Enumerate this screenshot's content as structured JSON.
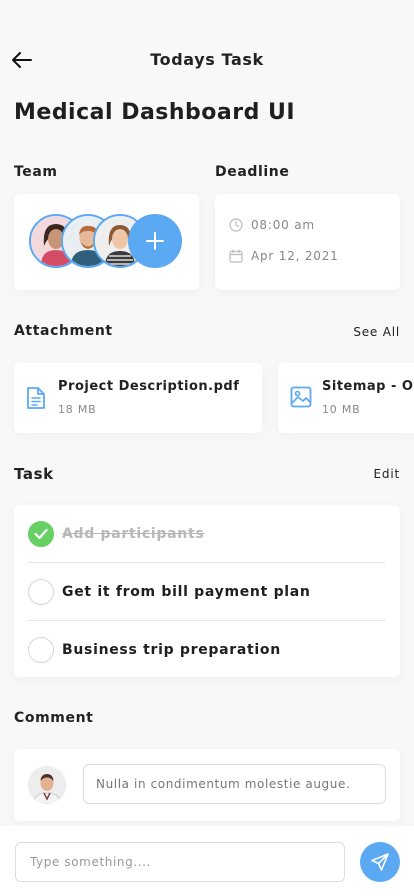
{
  "header": {
    "title": "Todays Task",
    "back_icon": "arrow-left-icon"
  },
  "page_title": "Medical Dashboard UI",
  "team": {
    "label": "Team",
    "add_icon": "plus-icon"
  },
  "deadline": {
    "label": "Deadline",
    "time": "08:00 am",
    "date": "Apr 12, 2021"
  },
  "attachments": {
    "label": "Attachment",
    "see_all": "See All",
    "items": [
      {
        "name": "Project Description.pdf",
        "size": "18 MB",
        "icon": "document-icon"
      },
      {
        "name": "Sitemap - Over",
        "size": "10 MB",
        "icon": "image-icon"
      }
    ]
  },
  "tasks": {
    "label": "Task",
    "edit": "Edit",
    "items": [
      {
        "text": "Add participants",
        "done": true
      },
      {
        "text": "Get it from bill payment plan",
        "done": false
      },
      {
        "text": "Business trip preparation",
        "done": false
      }
    ]
  },
  "comment": {
    "label": "Comment",
    "text": "Nulla in condimentum molestie augue."
  },
  "compose": {
    "placeholder": "Type something...."
  },
  "colors": {
    "accent": "#5aa9f2",
    "success": "#67d065",
    "background": "#f8f8f8"
  }
}
